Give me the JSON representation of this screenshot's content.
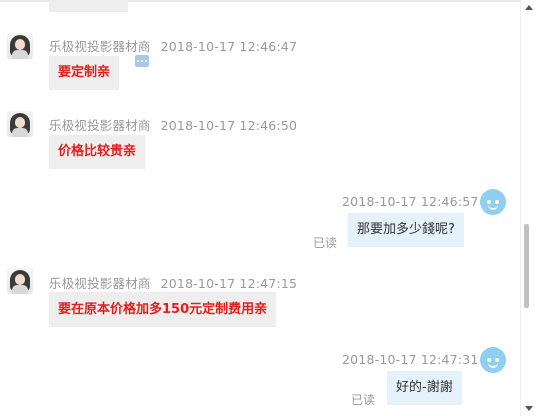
{
  "messages": [
    {
      "sender": "乐极视投影器材商",
      "time": "2018-10-17 12:46:47",
      "text": "要定制亲"
    },
    {
      "sender": "乐极视投影器材商",
      "time": "2018-10-17 12:46:50",
      "text": "价格比较贵亲"
    },
    {
      "time": "2018-10-17 12:46:57",
      "text": "那要加多少錢呢?",
      "status": "已读"
    },
    {
      "sender": "乐极视投影器材商",
      "time": "2018-10-17 12:47:15",
      "text": "要在原本价格加多150元定制费用亲"
    },
    {
      "time": "2018-10-17 12:47:31",
      "text": "好的-謝謝",
      "status": "已读"
    }
  ],
  "colors": {
    "seller_text": "#e02020",
    "bubble_in": "#eeeeee",
    "bubble_out": "#e5f1fb",
    "meta": "#999999"
  },
  "icons": {
    "message_icon": "chat-more-icon",
    "my_avatar": "smiley-avatar-icon"
  }
}
